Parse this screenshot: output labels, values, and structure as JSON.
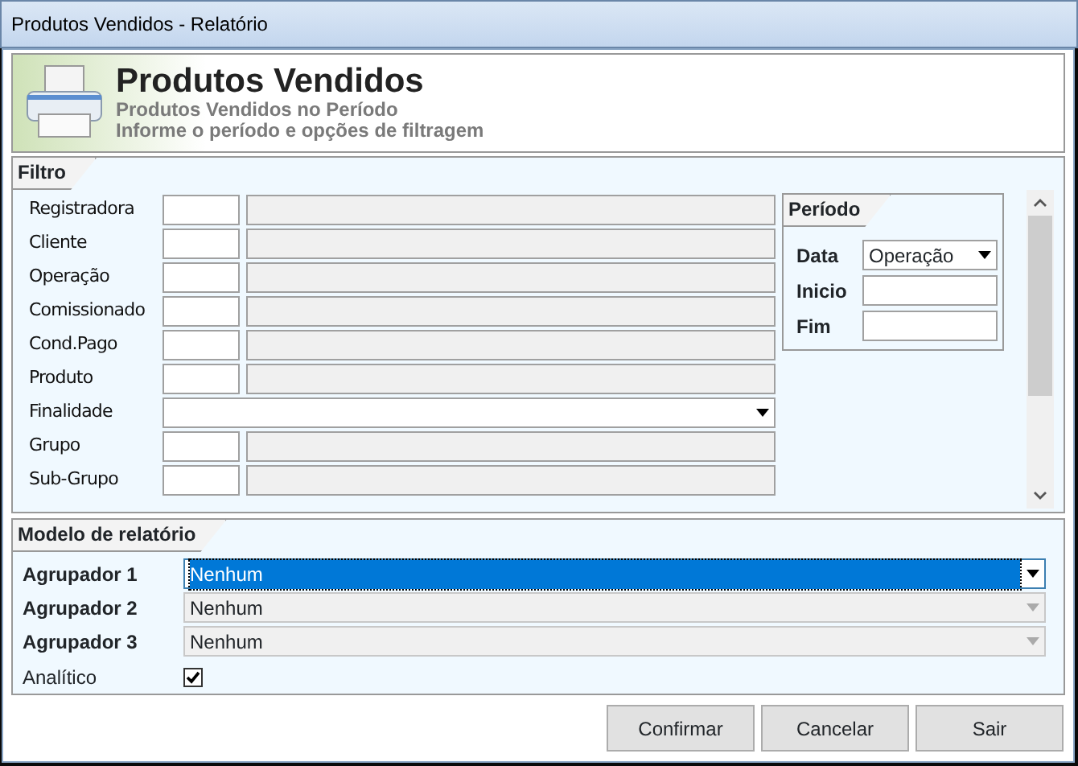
{
  "window": {
    "title": "Produtos Vendidos - Relatório"
  },
  "header": {
    "title": "Produtos Vendidos",
    "subtitle": "Produtos Vendidos no Período",
    "hint": "Informe o período e opções de filtragem"
  },
  "filter": {
    "title": "Filtro",
    "rows": [
      {
        "kind": "lookup",
        "label": "Registradora"
      },
      {
        "kind": "lookup",
        "label": "Cliente"
      },
      {
        "kind": "lookup",
        "label": "Operação"
      },
      {
        "kind": "lookup",
        "label": "Comissionado"
      },
      {
        "kind": "lookup",
        "label": "Cond.Pago"
      },
      {
        "kind": "lookup",
        "label": "Produto"
      },
      {
        "kind": "select",
        "label": "Finalidade"
      },
      {
        "kind": "lookup",
        "label": "Grupo"
      },
      {
        "kind": "lookup",
        "label": "Sub-Grupo"
      }
    ],
    "period": {
      "title": "Período",
      "date_label": "Data",
      "date_value": "Operação",
      "start_label": "Inicio",
      "end_label": "Fim"
    }
  },
  "report_model": {
    "title": "Modelo de relatório",
    "groupers": [
      {
        "label": "Agrupador 1",
        "value": "Nenhum",
        "selected": true,
        "disabled": false
      },
      {
        "label": "Agrupador 2",
        "value": "Nenhum",
        "selected": false,
        "disabled": true
      },
      {
        "label": "Agrupador 3",
        "value": "Nenhum",
        "selected": false,
        "disabled": true
      }
    ],
    "analytic": {
      "label": "Analítico",
      "checked": true
    }
  },
  "buttons": [
    "Confirmar",
    "Cancelar",
    "Sair"
  ]
}
